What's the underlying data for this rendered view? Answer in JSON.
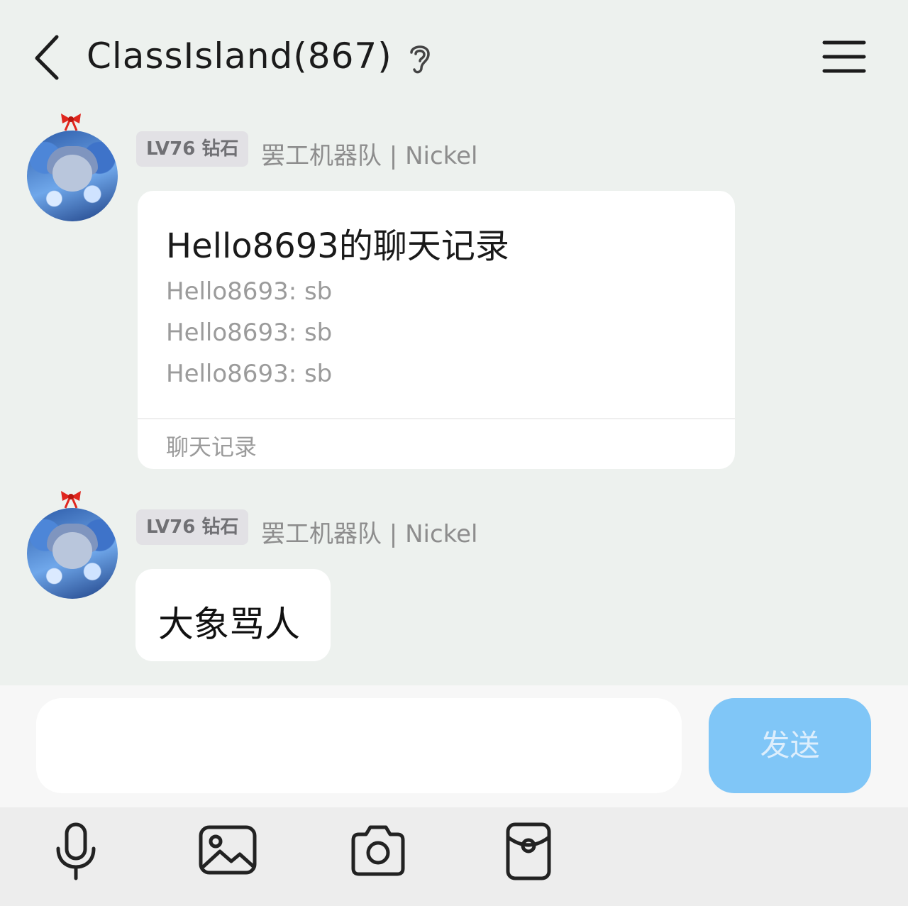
{
  "header": {
    "title": "ClassIsland(867)",
    "icons": [
      "back-arrow-icon",
      "ear-icon",
      "menu-icon"
    ]
  },
  "messages": [
    {
      "badge": "LV76 钻石",
      "sender": "罢工机器队 | Nickel",
      "forward_card": {
        "title": "Hello8693的聊天记录",
        "lines": [
          "Hello8693: sb",
          "Hello8693: sb",
          "Hello8693: sb"
        ],
        "footer": "聊天记录"
      }
    },
    {
      "badge": "LV76 钻石",
      "sender": "罢工机器队 | Nickel",
      "text": "大象骂人"
    }
  ],
  "input": {
    "value": "",
    "send_label": "发送"
  },
  "toolbar": {
    "icons": [
      "microphone-icon",
      "image-icon",
      "camera-icon",
      "red-packet-icon"
    ]
  },
  "colors": {
    "background": "#edf1ee",
    "send_button": "#80c6f7",
    "bow": "#e0261e"
  }
}
